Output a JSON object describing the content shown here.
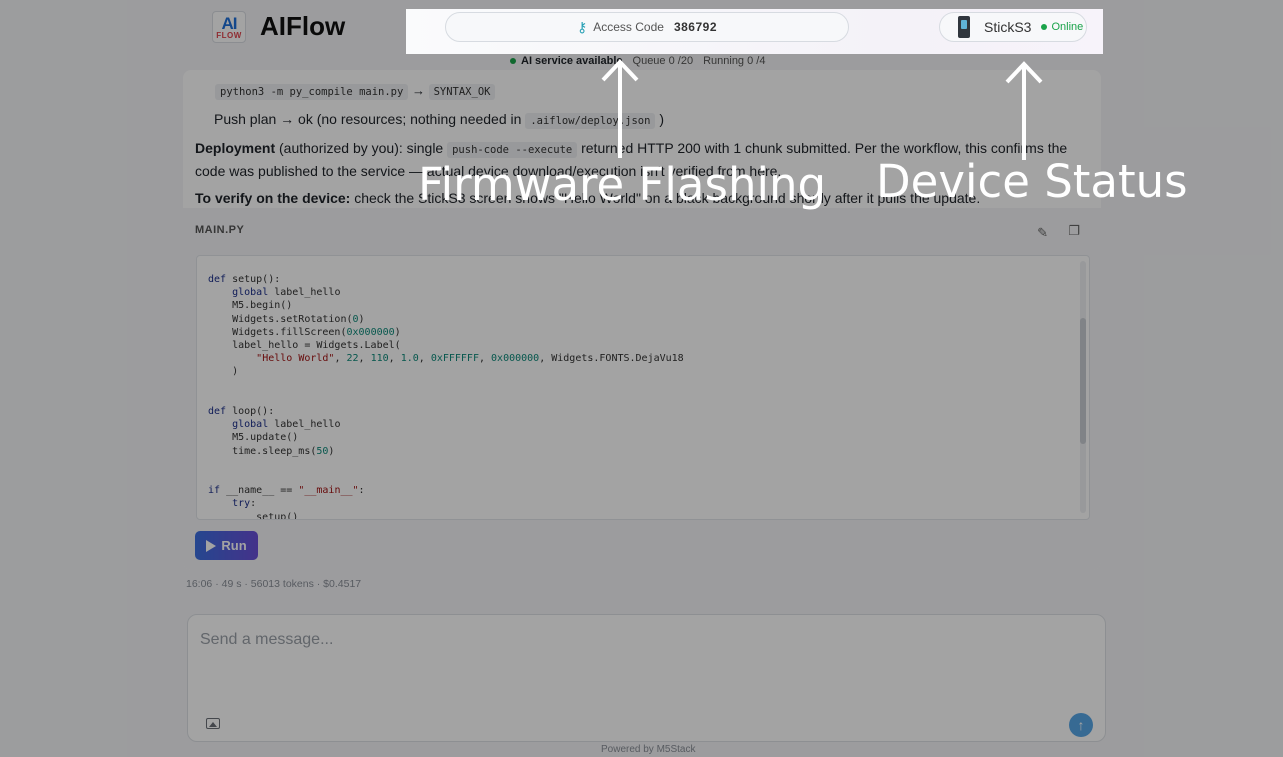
{
  "brand": {
    "logo_top": "AI",
    "logo_bottom": "FLOW",
    "name": "AIFlow"
  },
  "topbar": {
    "access_label": "Access Code",
    "access_code": "386792",
    "device_name": "StickS3",
    "device_status": "Online"
  },
  "status": {
    "service": "AI service available",
    "queue": "Queue 0 /20",
    "running": "Running 0 /4"
  },
  "message": {
    "line1_code": "python3 -m py_compile main.py",
    "line1_arrow": "→",
    "line1_result": "SYNTAX_OK",
    "line2_text": "Push plan → ok (no resources; nothing needed in",
    "line2_code": ".aiflow/deploy.json",
    "line2_end": ")",
    "deploy_label": "Deployment",
    "deploy_text_1": "(authorized by you): single",
    "deploy_code": "push-code --execute",
    "deploy_text_2": "returned HTTP 200 with 1 chunk submitted. Per the workflow, this confirms the code was published to the service — actual device download/execution isn't verified from here.",
    "verify_label": "To verify on the device:",
    "verify_text": "check the StickS3 screen shows \"Hello World\" on a black background shortly after it pulls the update."
  },
  "code": {
    "filename": "MAIN.PY",
    "run_label": "Run"
  },
  "meta": "16:06 · 49 s · 56013 tokens · $0.4517",
  "composer": {
    "placeholder": "Send a message..."
  },
  "footer": "Powered by M5Stack",
  "annotations": {
    "firmware": "Firmware Flashing",
    "device": "Device Status"
  },
  "icons": {
    "key": "key-icon",
    "edit": "pencil-icon",
    "copy": "copy-icon",
    "image": "image-icon",
    "send": "send-arrow-icon",
    "play": "play-icon"
  },
  "colors": {
    "online_green": "#1aa34a",
    "run_button_start": "#3b6fe0",
    "run_button_end": "#6b4fd8"
  }
}
